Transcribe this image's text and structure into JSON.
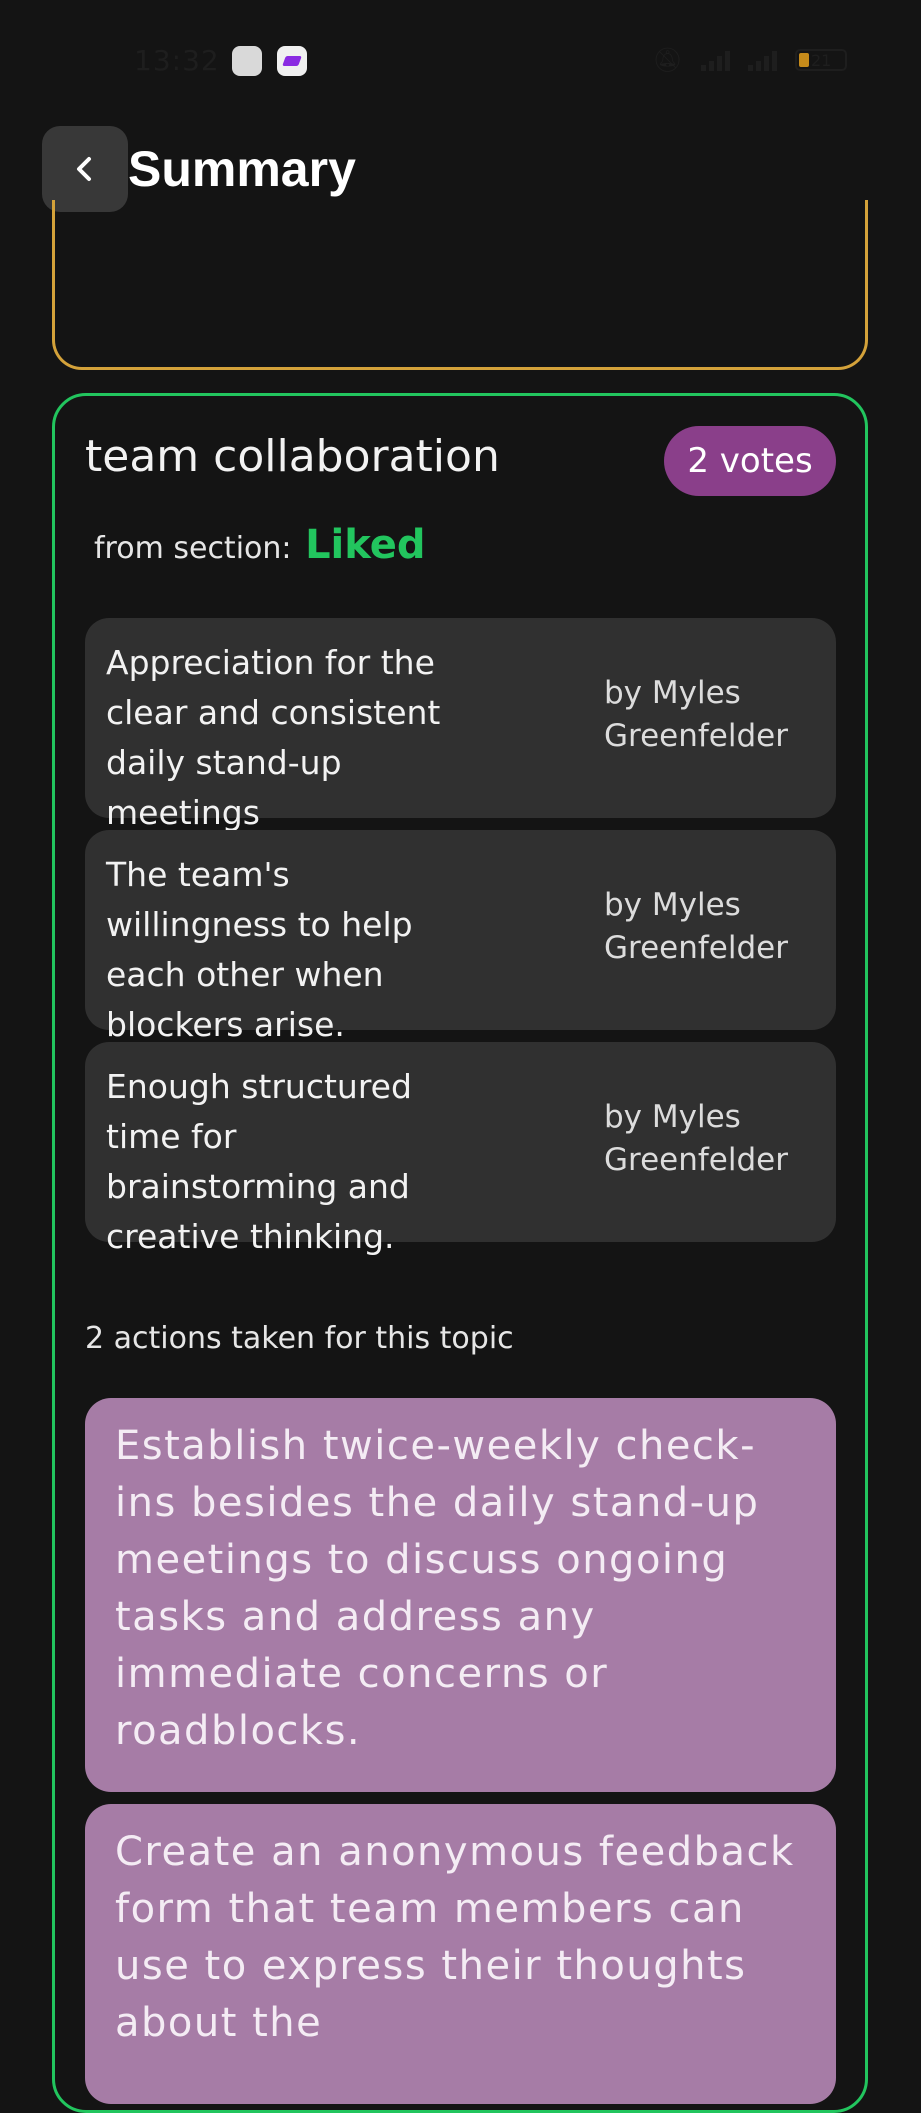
{
  "status_bar": {
    "time": "13:32",
    "battery_level": "21"
  },
  "header": {
    "title": "Summary"
  },
  "topic": {
    "title": "team collaboration",
    "votes_label": "2 votes",
    "from_section_label": "from section:",
    "section_name": "Liked",
    "notes": [
      {
        "text": "Appreciation for the clear and consistent daily stand-up meetings",
        "author": "by Myles Greenfelder"
      },
      {
        "text": "The team's willingness to help each other when blockers arise.",
        "author": "by Myles Greenfelder"
      },
      {
        "text": "Enough structured time for brainstorming and creative thinking.",
        "author": "by Myles Greenfelder"
      }
    ],
    "actions_label": "2 actions taken for this topic",
    "actions": [
      {
        "text": "Establish twice-weekly check-ins besides the daily stand-up meetings to discuss ongoing tasks and address any immediate concerns or roadblocks."
      },
      {
        "text": "Create an anonymous feedback form that team members can use to express their thoughts about the"
      }
    ]
  },
  "colors": {
    "background": "#141414",
    "liked_accent": "#22c55e",
    "previous_card_border": "#d4a23a",
    "votes_badge": "#8a3f8a",
    "action_card": "#a67ca6",
    "note_card": "#303030"
  }
}
